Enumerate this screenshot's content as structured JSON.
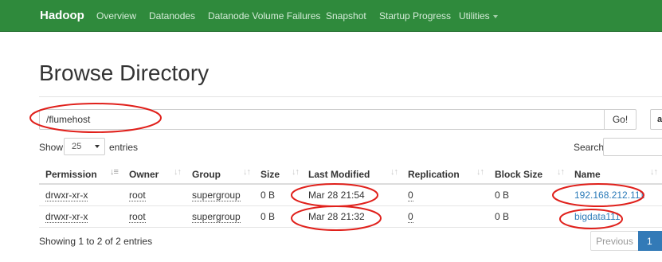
{
  "navbar": {
    "brand": "Hadoop",
    "items": [
      {
        "label": "Overview"
      },
      {
        "label": "Datanodes"
      },
      {
        "label": "Datanode Volume Failures"
      },
      {
        "label": "Snapshot"
      },
      {
        "label": "Startup Progress"
      },
      {
        "label": "Utilities"
      }
    ],
    "background_color": "#2f8a3c"
  },
  "page": {
    "title": "Browse Directory",
    "path_value": "/flumehost",
    "go_label": "Go!",
    "extra_button_glyph": "a",
    "show_label": "Show",
    "entries_per_page": "25",
    "entries_label": "entries",
    "search_label": "Search:"
  },
  "table": {
    "columns": [
      "Permission",
      "Owner",
      "Group",
      "Size",
      "Last Modified",
      "Replication",
      "Block Size",
      "Name"
    ],
    "sorted_column": "Permission",
    "rows": [
      {
        "permission": "drwxr-xr-x",
        "owner": "root",
        "group": "supergroup",
        "size": "0 B",
        "last_modified": "Mar 28 21:54",
        "replication": "0",
        "block_size": "0 B",
        "name": "192.168.212.111"
      },
      {
        "permission": "drwxr-xr-x",
        "owner": "root",
        "group": "supergroup",
        "size": "0 B",
        "last_modified": "Mar 28 21:32",
        "replication": "0",
        "block_size": "0 B",
        "name": "bigdata111"
      }
    ]
  },
  "footer": {
    "info": "Showing 1 to 2 of 2 entries",
    "previous_label": "Previous",
    "current_page": "1"
  },
  "annotations": {
    "color": "#e0201b"
  }
}
